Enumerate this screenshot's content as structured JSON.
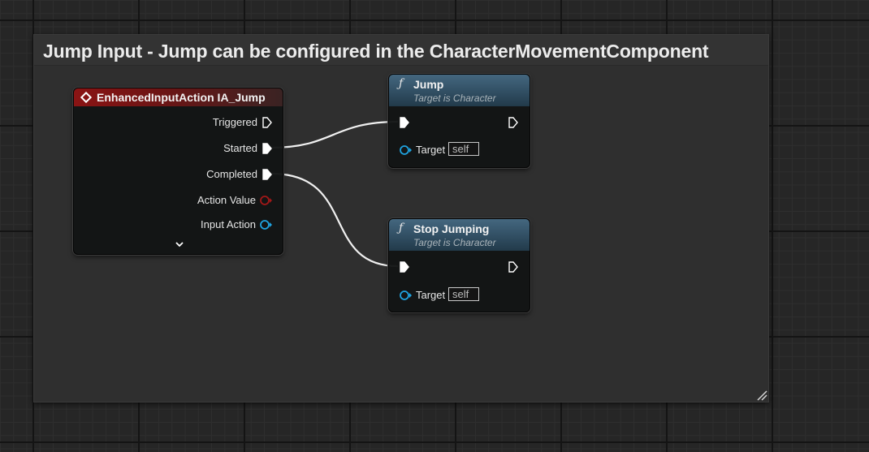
{
  "comment": {
    "title": "Jump Input - Jump can be configured in the CharacterMovementComponent"
  },
  "event_node": {
    "title": "EnhancedInputAction IA_Jump",
    "icon": "event-diamond-icon",
    "header_color": "#8a1414",
    "pins": {
      "triggered": "Triggered",
      "started": "Started",
      "completed": "Completed",
      "action_value": "Action Value",
      "input_action": "Input Action"
    },
    "expand_icon": "chevron-down-icon"
  },
  "jump_node": {
    "title": "Jump",
    "subtitle": "Target is Character",
    "icon": "function-icon",
    "target_label": "Target",
    "target_value": "self"
  },
  "stop_jumping_node": {
    "title": "Stop Jumping",
    "subtitle": "Target is Character",
    "icon": "function-icon",
    "target_label": "Target",
    "target_value": "self"
  },
  "colors": {
    "exec_pin": "#ffffff",
    "object_pin": "#1fa3e0",
    "struct_pin": "#a31818",
    "function_header": "#3a5a70"
  }
}
